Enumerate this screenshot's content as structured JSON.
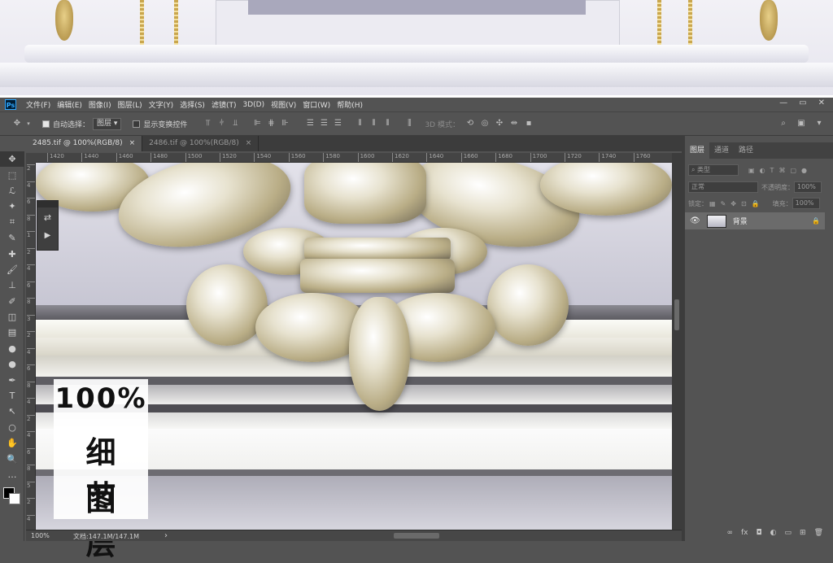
{
  "app": {
    "logo": "Ps"
  },
  "menu": [
    "文件(F)",
    "编辑(E)",
    "图像(I)",
    "图层(L)",
    "文字(Y)",
    "选择(S)",
    "滤镜(T)",
    "3D(D)",
    "视图(V)",
    "窗口(W)",
    "帮助(H)"
  ],
  "window_controls": [
    "—",
    "▭",
    "✕"
  ],
  "options": {
    "auto_select_label": "自动选择：",
    "auto_select_checked": true,
    "auto_select_value": "图层",
    "show_transform_label": "显示变换控件",
    "show_transform_checked": false,
    "mode_3d_label": "3D 模式："
  },
  "tabs": [
    {
      "label": "2485.tif @ 100%(RGB/8)",
      "close": "×",
      "active": true
    },
    {
      "label": "2486.tif @ 100%(RGB/8)",
      "close": "×",
      "active": false
    }
  ],
  "ruler_h": [
    "1420",
    "1440",
    "1460",
    "1480",
    "1500",
    "1520",
    "1540",
    "1560",
    "1580",
    "1600",
    "1620",
    "1640",
    "1660",
    "1680",
    "1700",
    "1720",
    "1740",
    "1760"
  ],
  "ruler_v": [
    "2",
    "4",
    "6",
    "8",
    "1",
    "2",
    "4",
    "6",
    "8",
    "3",
    "2",
    "4",
    "6",
    "8",
    "4",
    "2",
    "4",
    "6",
    "8",
    "5",
    "2",
    "4"
  ],
  "canvas_label": {
    "line1": "100%",
    "line2": "细节",
    "line3": "图层"
  },
  "status": {
    "zoom": "100%",
    "doc": "文档:147.1M/147.1M",
    "arrow": "›"
  },
  "layers_panel": {
    "tabs": [
      "图层",
      "通道",
      "路径"
    ],
    "filter_kind": "类型",
    "blend_mode": "正常",
    "opacity_label": "不透明度：",
    "opacity_value": "100%",
    "lock_label": "锁定：",
    "fill_label": "填充：",
    "fill_value": "100%",
    "layers": [
      {
        "name": "背景",
        "visible": true,
        "locked": true
      }
    ],
    "bottom_icons": [
      "link-icon",
      "fx-icon",
      "mask-icon",
      "adjustment-icon",
      "group-icon",
      "new-layer-icon",
      "trash-icon"
    ],
    "bottom_glyphs": [
      "∞",
      "fx",
      "◘",
      "◐",
      "▭",
      "⊞",
      "🗑"
    ]
  },
  "tools": [
    "move-icon",
    "marquee-icon",
    "lasso-icon",
    "magic-wand-icon",
    "crop-icon",
    "eyedropper-icon",
    "healing-icon",
    "brush-icon",
    "stamp-icon",
    "history-brush-icon",
    "eraser-icon",
    "gradient-icon",
    "blur-icon",
    "dodge-icon",
    "pen-icon",
    "type-icon",
    "path-select-icon",
    "shape-icon",
    "hand-icon",
    "zoom-icon",
    "more-icon"
  ],
  "tool_glyphs": [
    "✥",
    "⬚",
    "ℒ",
    "✦",
    "⌗",
    "✎",
    "✚",
    "🖌",
    "⊥",
    "✐",
    "◫",
    "▤",
    "●",
    "●",
    "✒",
    "T",
    "↖",
    "○",
    "✋",
    "🔍",
    "…"
  ]
}
